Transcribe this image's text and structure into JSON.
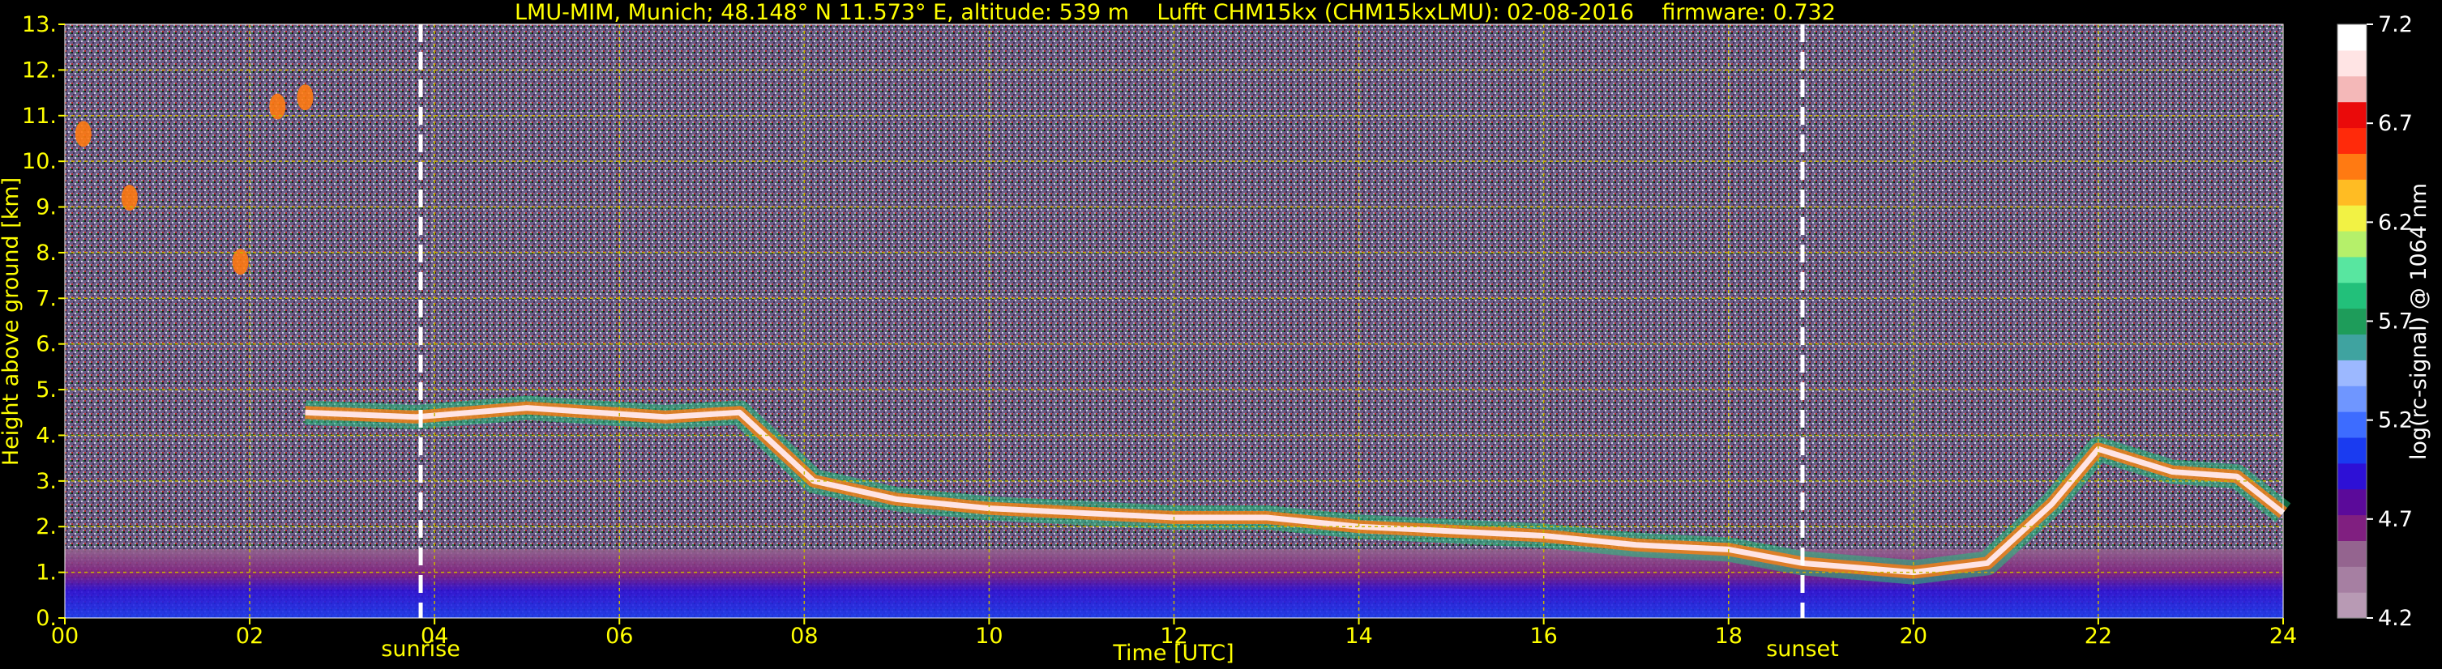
{
  "chart_data": {
    "type": "heatmap",
    "title": "LMU-MIM, Munich; 48.148° N 11.573° E, altitude: 539 m    Lufft CHM15kx (CHM15kxLMU): 02-08-2016    firmware: 0.732",
    "xlabel": "Time [UTC]",
    "ylabel": "Height above ground [km]",
    "xlim": [
      0,
      24
    ],
    "ylim": [
      0,
      13
    ],
    "x_ticks": [
      0,
      2,
      4,
      6,
      8,
      10,
      12,
      14,
      16,
      18,
      20,
      22,
      24
    ],
    "x_tick_labels": [
      "00",
      "02",
      "04",
      "06",
      "08",
      "10",
      "12",
      "14",
      "16",
      "18",
      "20",
      "22",
      "24"
    ],
    "y_ticks": [
      0,
      1,
      2,
      3,
      4,
      5,
      6,
      7,
      8,
      9,
      10,
      11,
      12,
      13
    ],
    "y_tick_labels": [
      "0.",
      "1.",
      "2.",
      "3.",
      "4.",
      "5.",
      "6.",
      "7.",
      "8.",
      "9.",
      "10.",
      "11.",
      "12.",
      "13."
    ],
    "grid": true,
    "events": [
      {
        "label": "sunrise",
        "x": 3.85
      },
      {
        "label": "sunset",
        "x": 18.8
      }
    ],
    "colorbar": {
      "label": "log(rc-signal) @ 1064 nm",
      "range": [
        4.2,
        7.2
      ],
      "ticks": [
        7.2,
        6.7,
        6.2,
        5.7,
        5.2,
        4.7,
        4.2
      ],
      "tick_labels": [
        "7.2",
        "6.7",
        "6.2",
        "5.7",
        "5.2",
        "4.7",
        "4.2"
      ],
      "colors": [
        "#b89ab4",
        "#a67fa2",
        "#94648f",
        "#801f80",
        "#5b0a9a",
        "#2d10d6",
        "#1a3bf0",
        "#3d6cff",
        "#6f96ff",
        "#9cb8ff",
        "#3fa3a0",
        "#1e9c5a",
        "#22c07a",
        "#58e6a0",
        "#b5f06a",
        "#f2f244",
        "#ffbc23",
        "#ff7a12",
        "#ff2a0a",
        "#ea0a0a",
        "#f4b8b8",
        "#ffe4e4",
        "#ffffff"
      ]
    },
    "features": [
      {
        "name": "boundary layer aerosol",
        "x_range": [
          0,
          24
        ],
        "height_range": [
          0,
          1.5
        ],
        "log_signal": 5.5
      },
      {
        "name": "elevated aerosol layer top",
        "points": [
          [
            2.6,
            4.5
          ],
          [
            3.8,
            4.4
          ],
          [
            5.0,
            4.6
          ],
          [
            6.5,
            4.4
          ],
          [
            7.3,
            4.5
          ],
          [
            8.1,
            3.0
          ],
          [
            9.0,
            2.6
          ],
          [
            10.0,
            2.4
          ],
          [
            11.0,
            2.3
          ],
          [
            12.0,
            2.2
          ],
          [
            13.0,
            2.2
          ],
          [
            14.0,
            2.0
          ],
          [
            15.0,
            1.9
          ],
          [
            16.0,
            1.8
          ],
          [
            17.0,
            1.6
          ],
          [
            18.0,
            1.5
          ],
          [
            18.8,
            1.2
          ],
          [
            20.0,
            1.0
          ],
          [
            20.8,
            1.2
          ],
          [
            21.5,
            2.5
          ],
          [
            22.0,
            3.7
          ],
          [
            22.8,
            3.2
          ],
          [
            23.5,
            3.1
          ],
          [
            24.0,
            2.3
          ]
        ],
        "log_signal": 7.0
      },
      {
        "name": "cirrus fragments",
        "points": [
          [
            0.2,
            10.6
          ],
          [
            0.7,
            9.2
          ],
          [
            1.9,
            7.8
          ],
          [
            2.3,
            11.2
          ],
          [
            2.6,
            11.4
          ]
        ],
        "log_signal": 6.5
      }
    ]
  },
  "colors": {
    "background": "#000000",
    "axes_text": "#ffff00",
    "grid": "#c8b400",
    "event_line": "#ffffff",
    "colorbar_text": "#ffffff"
  }
}
